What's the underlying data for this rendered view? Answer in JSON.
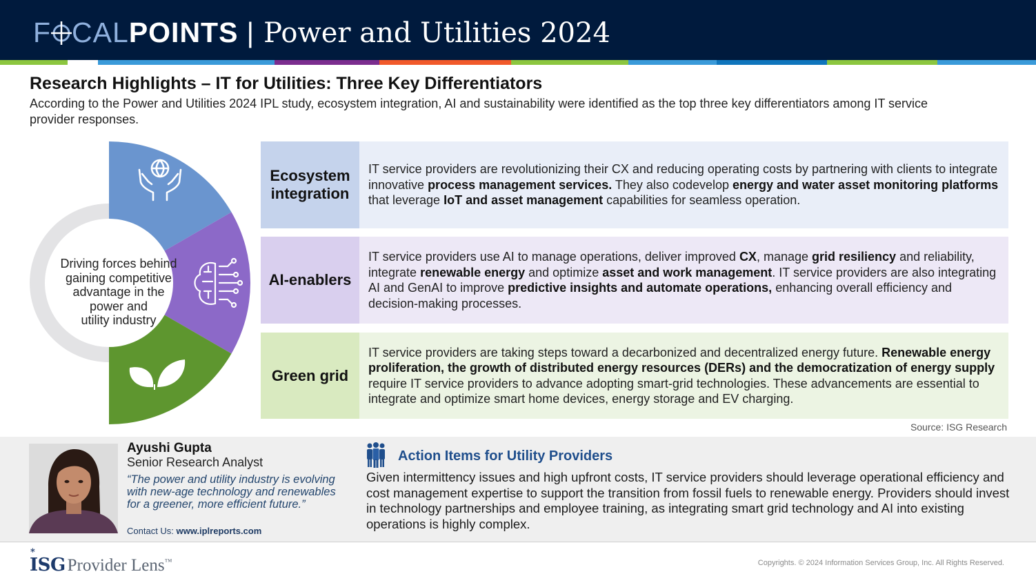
{
  "header": {
    "brand_focal": "F",
    "brand_focal_rest": "CAL",
    "brand_points": "POINTS",
    "separator": "|",
    "title": "Power and Utilities 2024"
  },
  "colors": {
    "navy": "#001a3d",
    "blue_segment": "#6a95cf",
    "purple_segment": "#8c69c8",
    "green_segment": "#5e962f",
    "ring_gray": "#e3e3e5",
    "accent_blue": "#1f4e8c"
  },
  "colorbar": [
    "#8cc63f",
    "#ffffff",
    "#3a9ad9",
    "#7b2d8e",
    "#f1592a",
    "#8cc63f",
    "#3a9ad9",
    "#0f75bc",
    "#8cc63f",
    "#3a9ad9"
  ],
  "main": {
    "title": "Research Highlights – IT for Utilities: Three Key Differentiators",
    "subtitle": "According to the Power and Utilities 2024 IPL study, ecosystem integration, AI and sustainability were identified as the top three key differentiators among IT service provider responses."
  },
  "donut": {
    "center_text_lines": [
      "Driving forces behind",
      "gaining competitive",
      "advantage in the",
      "power and",
      "utility industry"
    ],
    "icons": [
      "globe-hands-icon",
      "ai-brain-icon",
      "leaves-icon"
    ]
  },
  "differentiators": [
    {
      "label_line1": "Ecosystem",
      "label_line2": "integration",
      "segments": [
        {
          "t": "IT service providers are revolutionizing their CX and reducing operating costs by partnering with clients to integrate innovative ",
          "b": false
        },
        {
          "t": "process management services.",
          "b": true
        },
        {
          "t": " They also codevelop ",
          "b": false
        },
        {
          "t": "energy and water asset monitoring platforms",
          "b": true
        },
        {
          "t": " that leverage ",
          "b": false
        },
        {
          "t": "IoT and asset management",
          "b": true
        },
        {
          "t": " capabilities for seamless operation.",
          "b": false
        }
      ]
    },
    {
      "label_line1": "AI-enablers",
      "label_line2": "",
      "segments": [
        {
          "t": "IT service providers use AI to manage operations, deliver improved ",
          "b": false
        },
        {
          "t": "CX",
          "b": true
        },
        {
          "t": ", manage ",
          "b": false
        },
        {
          "t": "grid resiliency",
          "b": true
        },
        {
          "t": " and reliability, integrate ",
          "b": false
        },
        {
          "t": "renewable energy",
          "b": true
        },
        {
          "t": " and optimize ",
          "b": false
        },
        {
          "t": "asset and work management",
          "b": true
        },
        {
          "t": ". IT service providers are also integrating AI and GenAI to improve ",
          "b": false
        },
        {
          "t": "predictive insights and automate operations,",
          "b": true
        },
        {
          "t": " enhancing overall efficiency and decision-making processes.",
          "b": false
        }
      ]
    },
    {
      "label_line1": "Green grid",
      "label_line2": "",
      "segments": [
        {
          "t": "IT service providers are taking steps toward a decarbonized and decentralized energy future. ",
          "b": false
        },
        {
          "t": "Renewable energy proliferation, the growth of distributed energy resources (DERs) and the democratization of energy supply",
          "b": true
        },
        {
          "t": " require IT service providers to advance adopting smart-grid technologies. These advancements are essential to integrate and optimize smart home devices, energy storage and EV charging.",
          "b": false
        }
      ]
    }
  ],
  "source": "Source: ISG Research",
  "author": {
    "name": "Ayushi Gupta",
    "role": "Senior Research Analyst",
    "quote": "“The power and utility industry is evolving with new-age technology and renewables for a greener, more efficient future.”",
    "contact_label": "Contact Us: ",
    "contact_url": "www.iplreports.com"
  },
  "action": {
    "title": "Action Items for Utility Providers",
    "text": "Given intermittency issues and high upfront costs, IT service providers should leverage operational efficiency and cost management expertise to support the transition from fossil fuels to renewable energy. Providers should invest in technology partnerships and employee training, as integrating smart grid technology and AI into existing operations is highly complex."
  },
  "footer": {
    "logo_isg": "ISG",
    "logo_star": "*",
    "logo_provider": "Provider Lens",
    "logo_tm": "™",
    "copyright": "Copyrights. © 2024 Information Services Group, Inc. All Rights Reserved."
  }
}
